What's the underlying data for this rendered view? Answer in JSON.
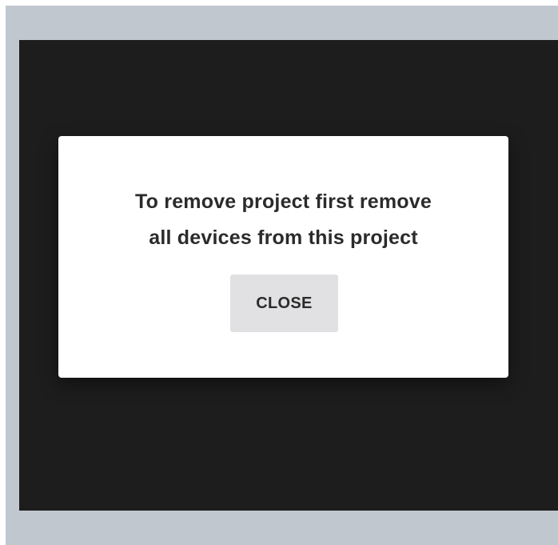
{
  "dialog": {
    "message_line1": "To remove project first remove",
    "message_line2": "all devices from this project",
    "close_label": "CLOSE"
  },
  "colors": {
    "frame_background": "#c1c7ce",
    "overlay_background": "#1d1d1d",
    "dialog_background": "#ffffff",
    "button_background": "#e1e1e3",
    "text": "#2b2b2b"
  }
}
